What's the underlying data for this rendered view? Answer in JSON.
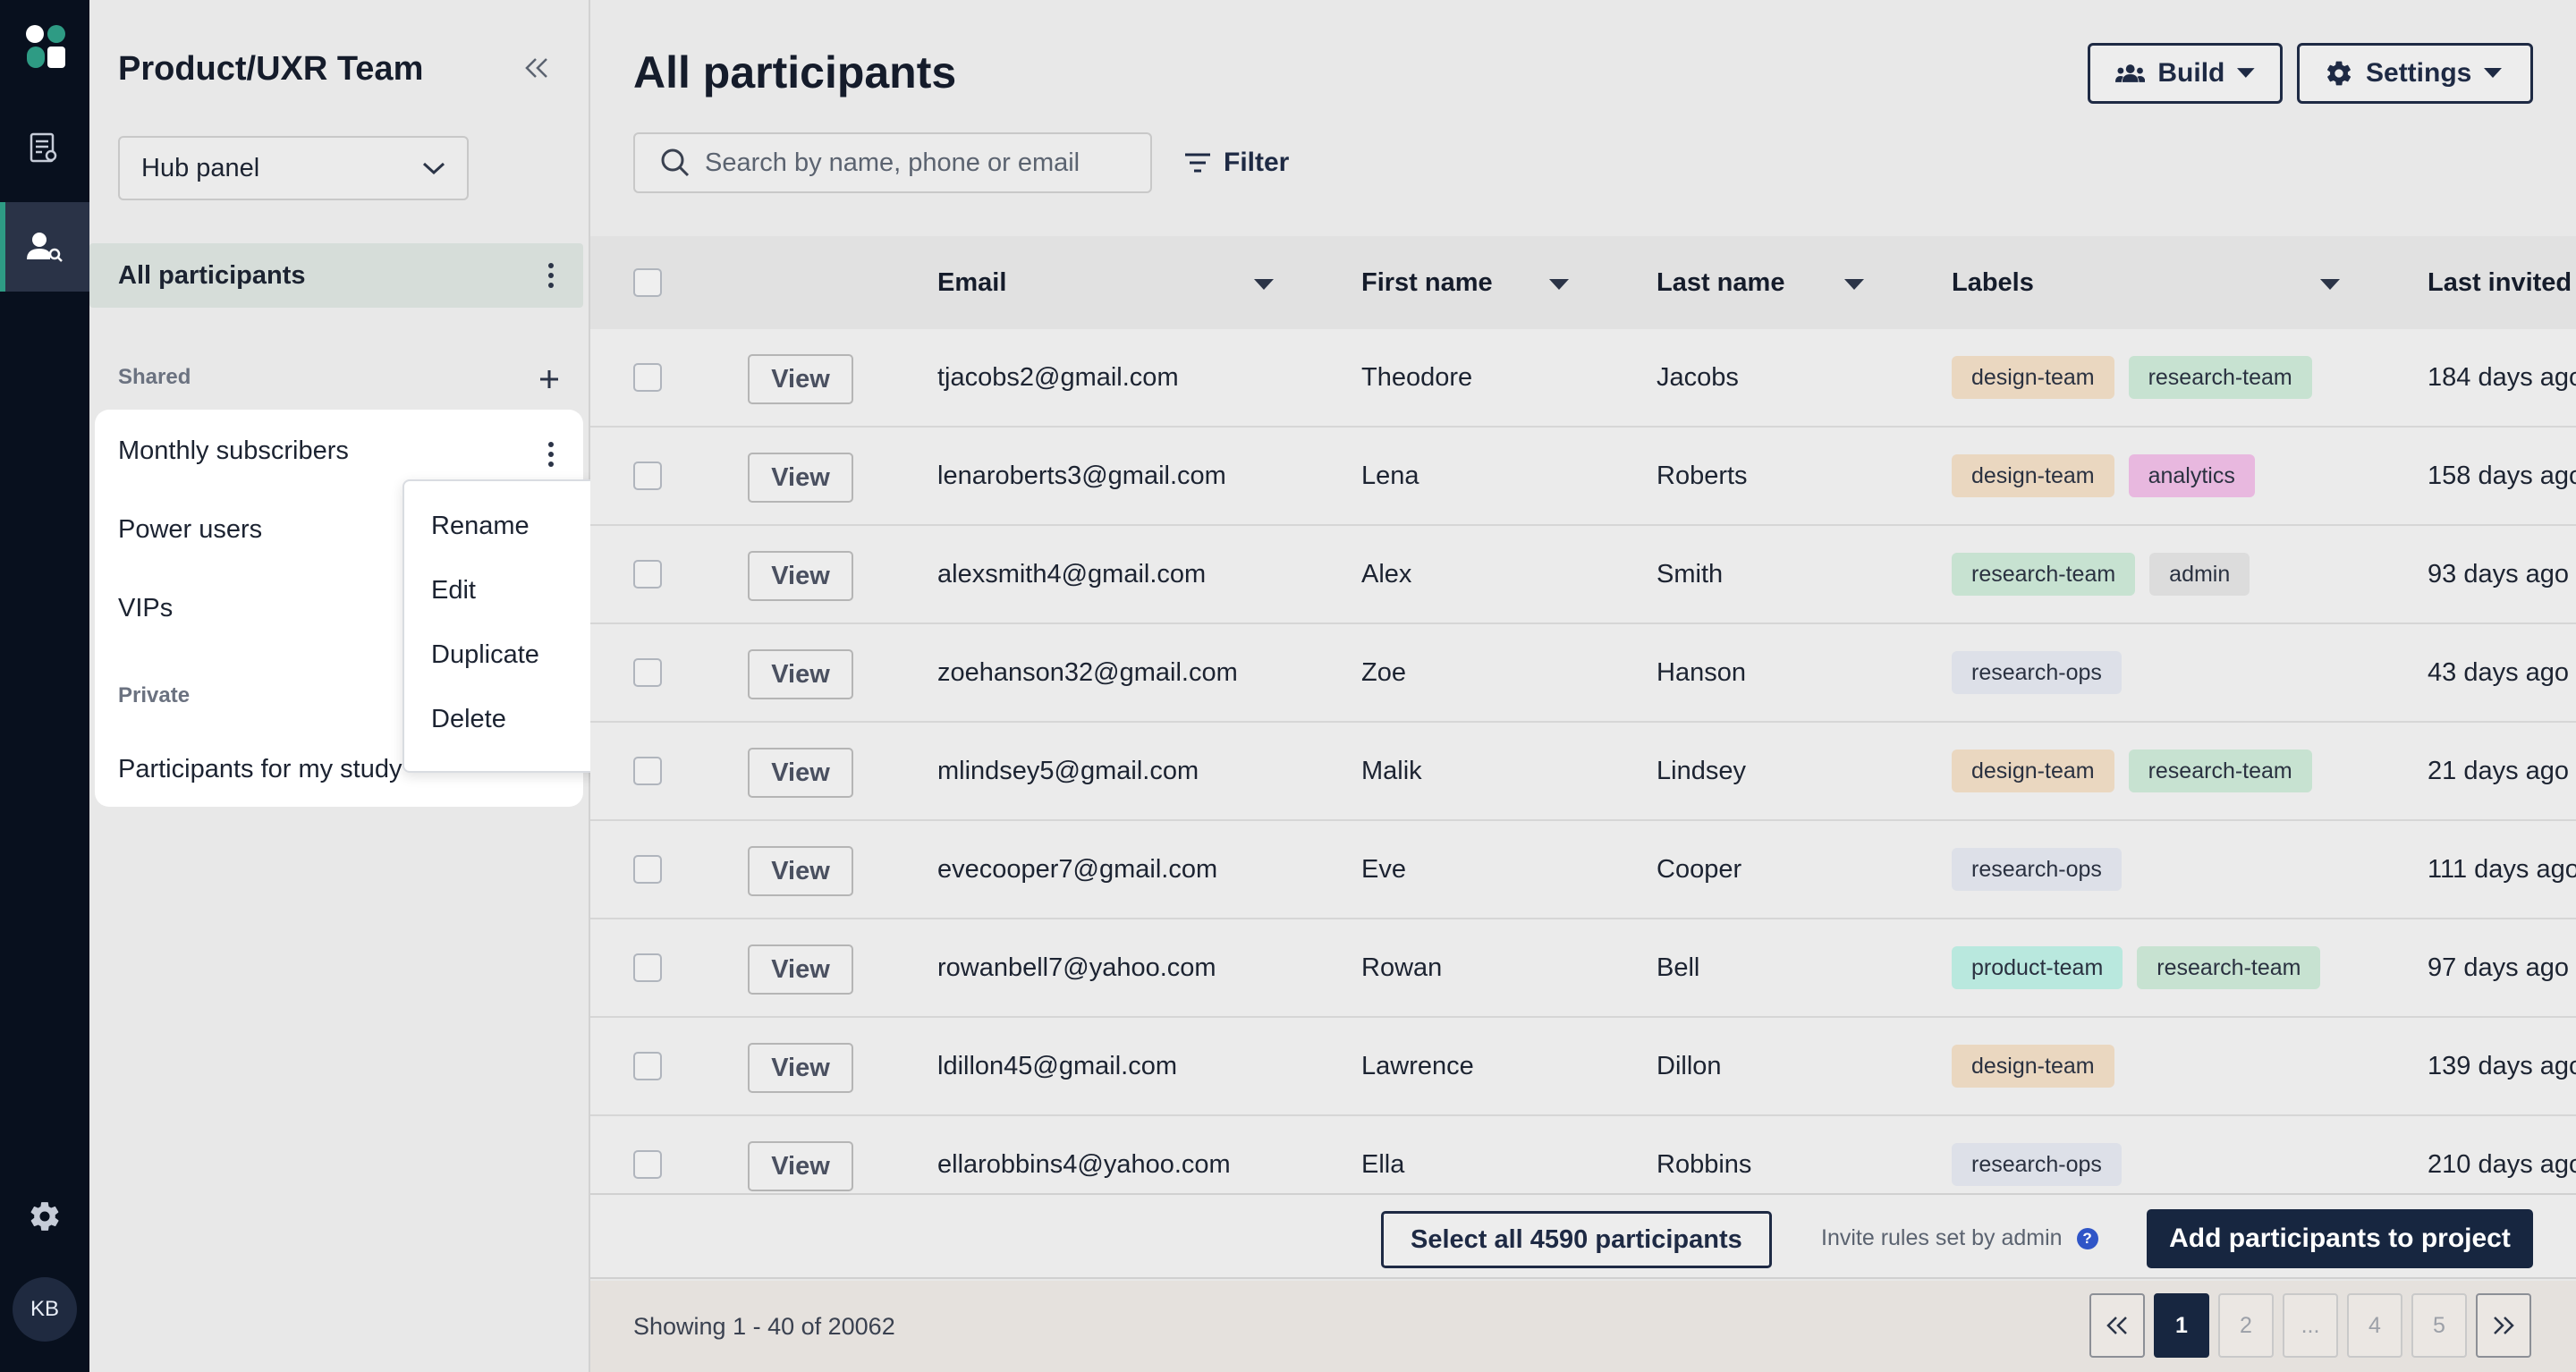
{
  "rail": {
    "avatar_initials": "KB",
    "icons": [
      "logo-icon",
      "reports-icon",
      "participants-icon",
      "settings-icon"
    ]
  },
  "sidebar": {
    "title": "Product/UXR Team",
    "panel_select": "Hub panel",
    "all_participants": "All participants",
    "shared_heading": "Shared",
    "shared_items": [
      "Monthly subscribers",
      "Power users",
      "VIPs"
    ],
    "private_heading": "Private",
    "private_items": [
      "Participants for my study"
    ],
    "context_menu": [
      "Rename",
      "Edit",
      "Duplicate",
      "Delete"
    ]
  },
  "header": {
    "title": "All participants",
    "build_label": "Build",
    "settings_label": "Settings",
    "search_placeholder": "Search by name, phone or email",
    "filter_label": "Filter"
  },
  "table": {
    "columns": [
      "Email",
      "First name",
      "Last name",
      "Labels",
      "Last invited"
    ],
    "view_label": "View",
    "rows": [
      {
        "email": "tjacobs2@gmail.com",
        "first": "Theodore",
        "last": "Jacobs",
        "labels": [
          "design-team",
          "research-team"
        ],
        "invited": "184 days ago"
      },
      {
        "email": "lenaroberts3@gmail.com",
        "first": "Lena",
        "last": "Roberts",
        "labels": [
          "design-team",
          "analytics"
        ],
        "invited": "158 days ago"
      },
      {
        "email": "alexsmith4@gmail.com",
        "first": "Alex",
        "last": "Smith",
        "labels": [
          "research-team",
          "admin"
        ],
        "invited": "93 days ago"
      },
      {
        "email": "zoehanson32@gmail.com",
        "first": "Zoe",
        "last": "Hanson",
        "labels": [
          "research-ops"
        ],
        "invited": "43 days ago"
      },
      {
        "email": "mlindsey5@gmail.com",
        "first": "Malik",
        "last": "Lindsey",
        "labels": [
          "design-team",
          "research-team"
        ],
        "invited": "21 days ago"
      },
      {
        "email": "evecooper7@gmail.com",
        "first": "Eve",
        "last": "Cooper",
        "labels": [
          "research-ops"
        ],
        "invited": "111 days ago"
      },
      {
        "email": "rowanbell7@yahoo.com",
        "first": "Rowan",
        "last": "Bell",
        "labels": [
          "product-team",
          "research-team"
        ],
        "invited": "97 days ago"
      },
      {
        "email": "ldillon45@gmail.com",
        "first": "Lawrence",
        "last": "Dillon",
        "labels": [
          "design-team"
        ],
        "invited": "139 days ago"
      },
      {
        "email": "ellarobbins4@yahoo.com",
        "first": "Ella",
        "last": "Robbins",
        "labels": [
          "research-ops"
        ],
        "invited": "210 days ago"
      }
    ]
  },
  "footer": {
    "select_all": "Select all 4590 participants",
    "invite_note": "Invite rules set by admin",
    "help_glyph": "?",
    "add_button": "Add participants to project",
    "showing": "Showing 1 - 40 of 20062",
    "pages": [
      "1",
      "2",
      "...",
      "4",
      "5"
    ]
  },
  "colors": {
    "rail": "#08101e",
    "accent_green": "#2e9b84",
    "primary_navy": "#172640",
    "help_blue": "#2f55c7"
  }
}
